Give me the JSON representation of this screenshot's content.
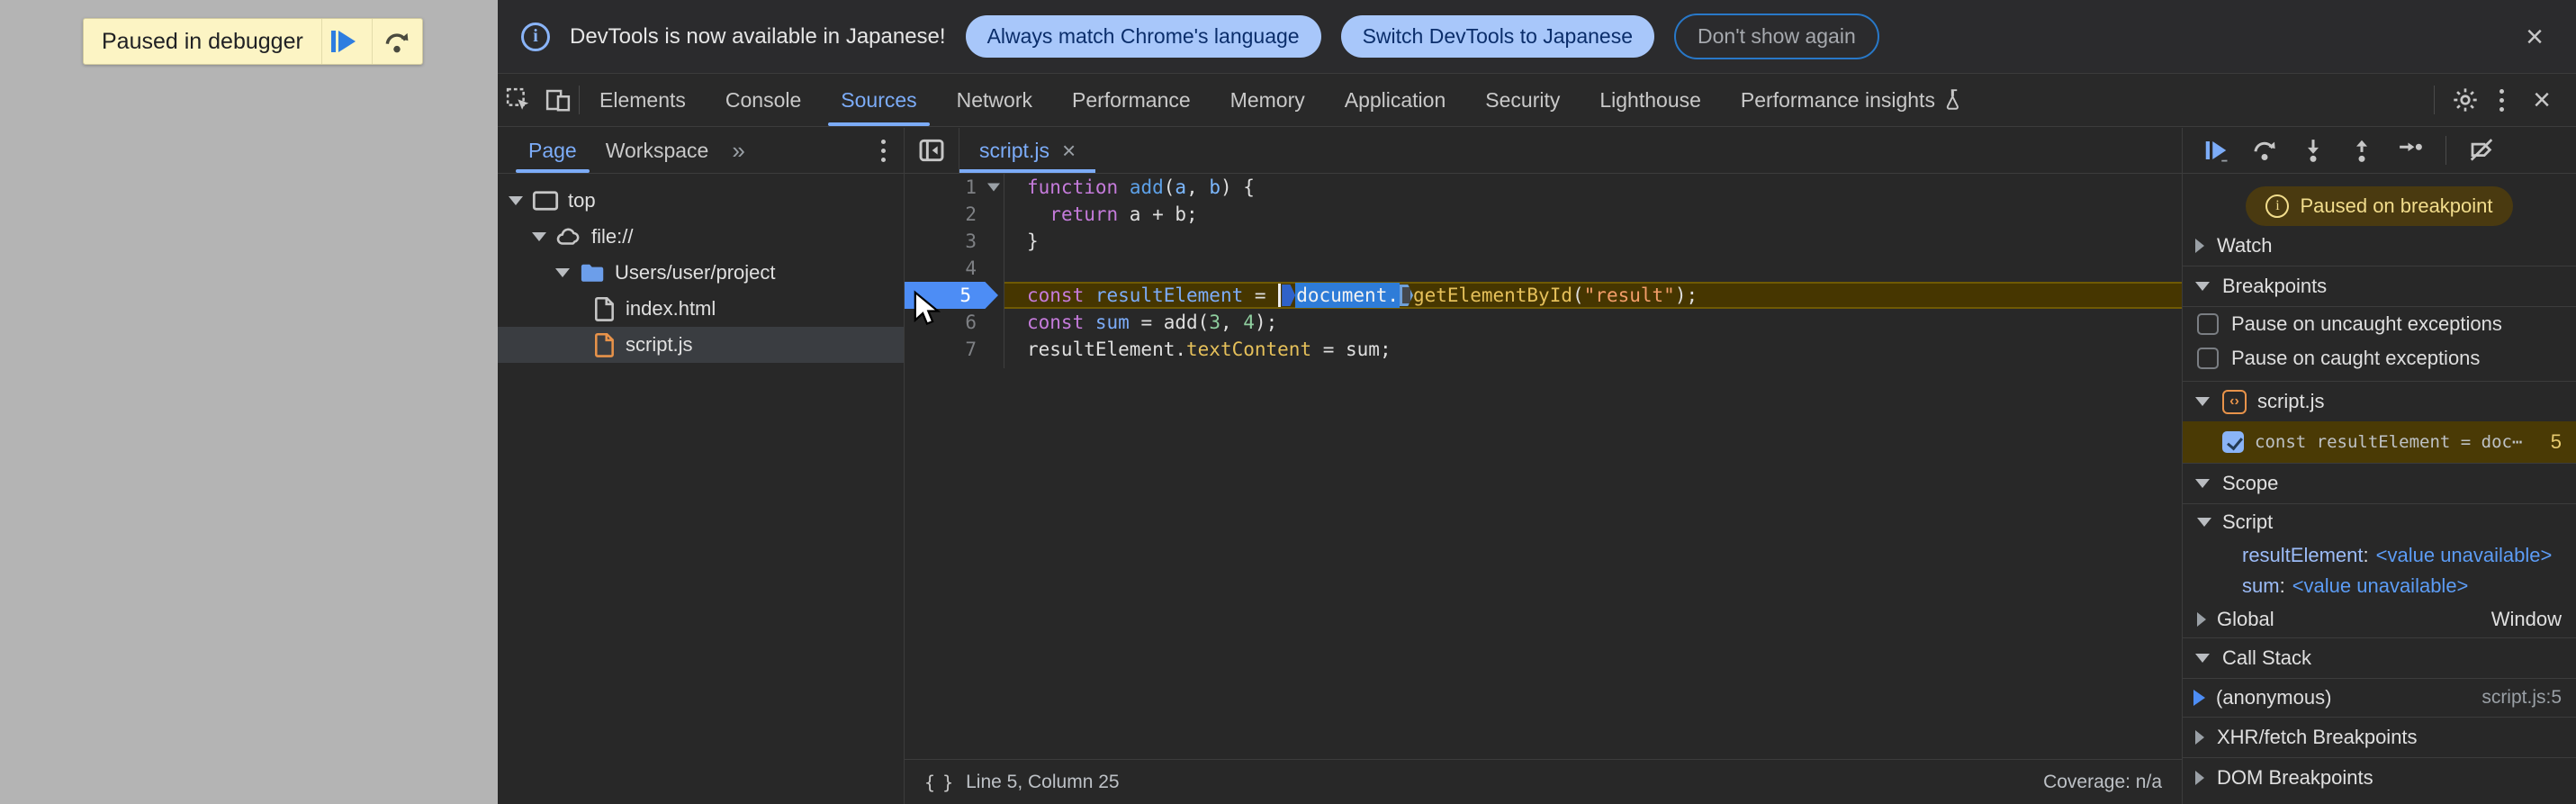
{
  "overlay": {
    "label": "Paused in debugger"
  },
  "notification": {
    "message": "DevTools is now available in Japanese!",
    "button_match": "Always match Chrome's language",
    "button_switch": "Switch DevTools to Japanese",
    "button_dismiss": "Don't show again"
  },
  "tabbar": {
    "tabs": [
      {
        "label": "Elements"
      },
      {
        "label": "Console"
      },
      {
        "label": "Sources"
      },
      {
        "label": "Network"
      },
      {
        "label": "Performance"
      },
      {
        "label": "Memory"
      },
      {
        "label": "Application"
      },
      {
        "label": "Security"
      },
      {
        "label": "Lighthouse"
      },
      {
        "label": "Performance insights"
      }
    ],
    "active_tab": "Sources"
  },
  "sidebar": {
    "tab_page": "Page",
    "tab_workspace": "Workspace",
    "tree": [
      {
        "label": "top"
      },
      {
        "label": "file://"
      },
      {
        "label": "Users/user/project"
      },
      {
        "label": "index.html"
      },
      {
        "label": "script.js"
      }
    ]
  },
  "editor": {
    "file_tab": "script.js",
    "status_left": "Line 5, Column 25",
    "status_right": "Coverage: n/a",
    "lines": [
      {
        "num": "1",
        "fold": true,
        "tokens": [
          [
            "function",
            "kw"
          ],
          [
            " ",
            "pl"
          ],
          [
            "add",
            "fn"
          ],
          [
            "(",
            "pl"
          ],
          [
            "a",
            "param"
          ],
          [
            ", ",
            "pl"
          ],
          [
            "b",
            "param"
          ],
          [
            ") {",
            "pl"
          ]
        ]
      },
      {
        "num": "2",
        "tokens": [
          [
            "  ",
            "pl"
          ],
          [
            "return",
            "kw"
          ],
          [
            " a + b;",
            "pl"
          ]
        ]
      },
      {
        "num": "3",
        "tokens": [
          [
            "}",
            "pl"
          ]
        ]
      },
      {
        "num": "4",
        "tokens": []
      },
      {
        "num": "5",
        "current": true,
        "tokens": [
          [
            "const",
            "kw"
          ],
          [
            " ",
            "pl"
          ],
          [
            "resultElement",
            "def"
          ],
          [
            " = ",
            "pl"
          ],
          [
            "",
            "caret"
          ],
          [
            "",
            "mark-on"
          ],
          [
            "document.",
            "sel"
          ],
          [
            "",
            "mark-off"
          ],
          [
            "getElementById",
            "prop"
          ],
          [
            "(",
            "pl"
          ],
          [
            "\"result\"",
            "str"
          ],
          [
            ");",
            "pl"
          ]
        ]
      },
      {
        "num": "6",
        "tokens": [
          [
            "const",
            "kw"
          ],
          [
            " ",
            "pl"
          ],
          [
            "sum",
            "def"
          ],
          [
            " = add(",
            "pl"
          ],
          [
            "3",
            "num"
          ],
          [
            ", ",
            "pl"
          ],
          [
            "4",
            "num"
          ],
          [
            ");",
            "pl"
          ]
        ]
      },
      {
        "num": "7",
        "tokens": [
          [
            "resultElement.",
            "pl"
          ],
          [
            "textContent",
            "prop"
          ],
          [
            " = sum;",
            "pl"
          ]
        ]
      }
    ]
  },
  "debugger": {
    "paused_badge": "Paused on breakpoint",
    "watch": "Watch",
    "breakpoints": "Breakpoints",
    "cb_uncaught": "Pause on uncaught exceptions",
    "cb_caught": "Pause on caught exceptions",
    "group_file": "script.js",
    "bp_label": "const resultElement = doc⋯",
    "bp_line": "5",
    "scope": "Scope",
    "scope_script": "Script",
    "var1_name": "resultElement",
    "var1_value": "<value unavailable>",
    "var2_name": "sum",
    "var2_value": "<value unavailable>",
    "global": "Global",
    "global_value": "Window",
    "call_stack": "Call Stack",
    "frame_name": "(anonymous)",
    "frame_location": "script.js:5",
    "xhr": "XHR/fetch Breakpoints",
    "dom": "DOM Breakpoints"
  },
  "icons": {
    "close": "×",
    "more_tabs": "»",
    "js_brackets": "‹›",
    "curly": "{ }",
    "info": "i"
  },
  "colors": {
    "accent_blue": "#7cacf8",
    "selection_blue": "#2e7cd8",
    "paused_line_bg": "#463600",
    "badge_bg": "#4a3a10",
    "badge_text": "#f2dd8c",
    "pill_bg": "#a8c7fa",
    "pill_text": "#0b2e6b",
    "js_orange": "#e8934a",
    "overlay_bg": "#fcf4c4"
  }
}
